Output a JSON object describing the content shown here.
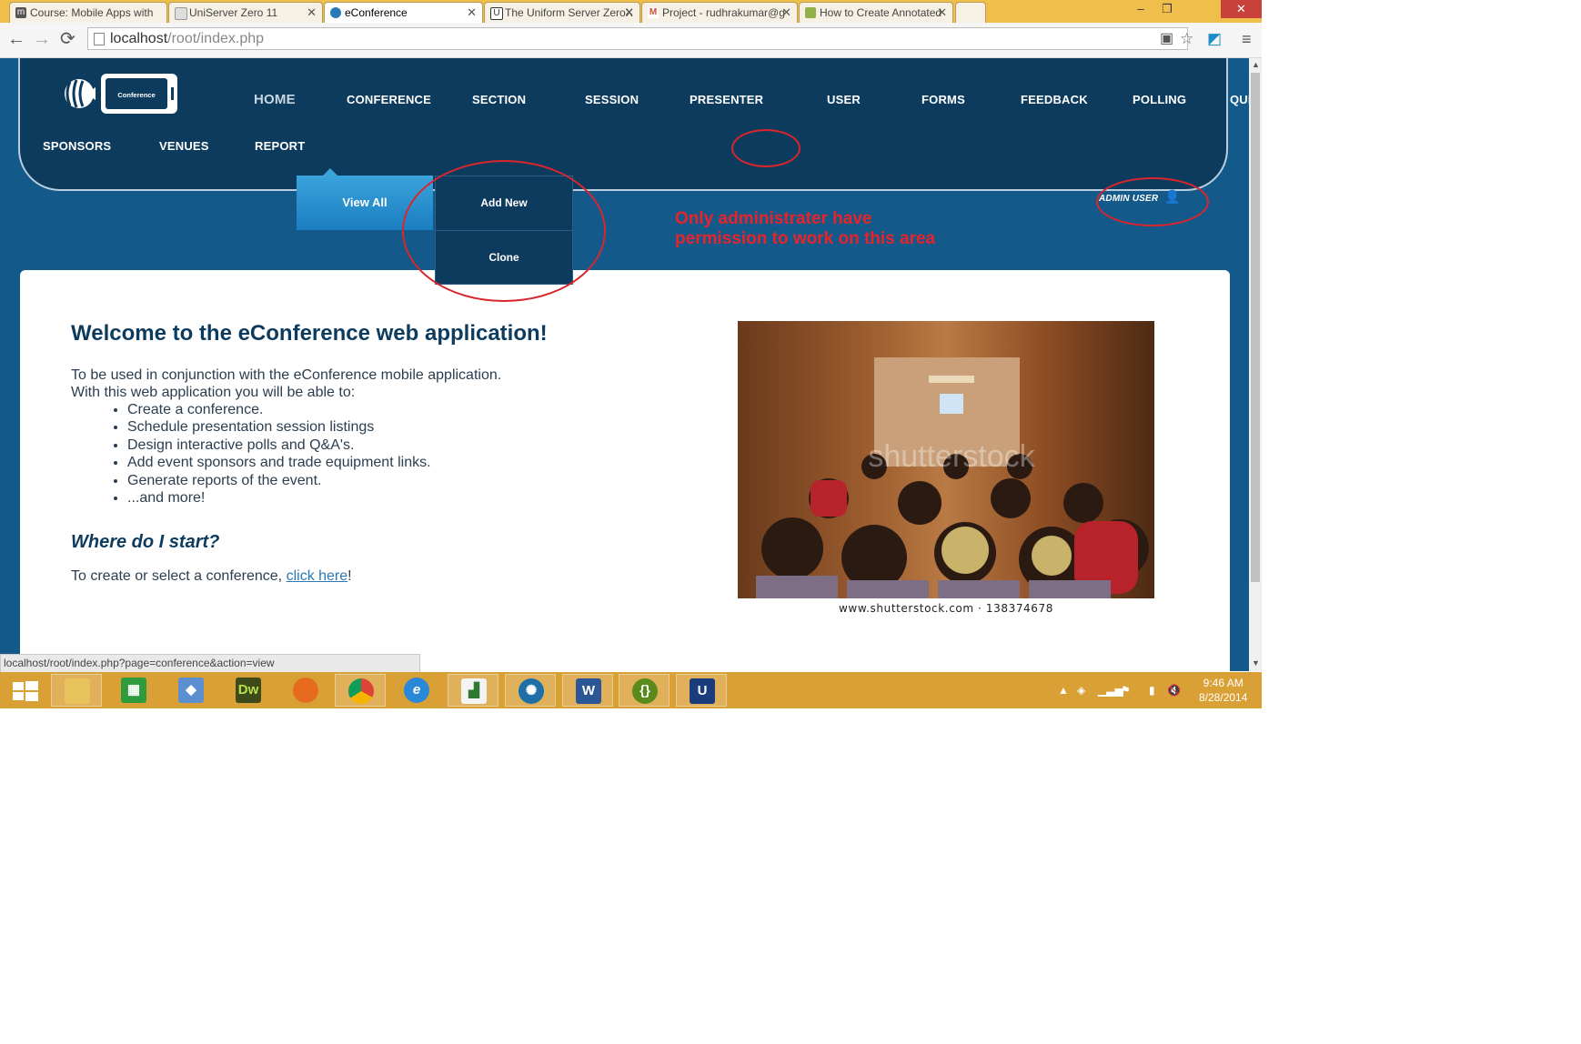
{
  "browser": {
    "tabs": [
      {
        "label": "Course: Mobile Apps with",
        "icon": "moodle-icon",
        "active": false
      },
      {
        "label": "UniServer Zero 11",
        "icon": "page-icon",
        "active": false
      },
      {
        "label": "eConference",
        "icon": "econference-icon",
        "active": true
      },
      {
        "label": "The Uniform Server ZeroX",
        "icon": "uniserver-icon",
        "active": false
      },
      {
        "label": "Project - rudhrakumar@g",
        "icon": "gmail-icon",
        "active": false
      },
      {
        "label": "How to Create Annotated",
        "icon": "wikihow-icon",
        "active": false
      }
    ],
    "address": {
      "host": "localhost",
      "path": "/root/index.php"
    },
    "window_controls": {
      "minimize": "–",
      "restore": "❐",
      "close": "✕"
    }
  },
  "site": {
    "logo_text": "Conference",
    "nav_row1": [
      "HOME",
      "CONFERENCE",
      "SECTION",
      "SESSION",
      "PRESENTER",
      "USER",
      "FORMS",
      "FEEDBACK",
      "POLLING",
      "QUESTIONS"
    ],
    "nav_row2": [
      "SPONSORS",
      "VENUES",
      "REPORT"
    ],
    "dropdown": {
      "view_all": "View All",
      "add_new": "Add New",
      "clone": "Clone"
    },
    "admin_user": "ADMIN USER",
    "annotation_note": "Only administrater have\npermission to work on this area",
    "annotation_color": "#e8232a"
  },
  "content": {
    "welcome": "Welcome to the eConference web application!",
    "intro_line1": "To be used in conjunction with the eConference mobile application.",
    "intro_line2": "With this web application you will be able to:",
    "features": [
      "Create a conference.",
      "Schedule presentation session listings",
      "Design interactive polls and Q&A's.",
      "Add event sponsors and trade equipment links.",
      "Generate reports of the event.",
      "...and more!"
    ],
    "start_heading": "Where do I start?",
    "start_text": "To create or select a conference, ",
    "start_link": "click here",
    "start_end": "!",
    "photo_caption": "www.shutterstock.com · 138374678",
    "photo_watermark": "shutterstock"
  },
  "status_bar": {
    "url": "localhost/root/index.php?page=conference&action=view"
  },
  "taskbar": {
    "apps": [
      "start-button",
      "file-explorer",
      "store",
      "virtualbox",
      "dreamweaver",
      "firefox",
      "chrome",
      "internet-explorer",
      "sheet-app",
      "network-app",
      "word",
      "brackets",
      "uniserver"
    ],
    "clock_time": "9:46 AM",
    "clock_date": "8/28/2014"
  },
  "colors": {
    "header_bg": "#0d3b5e",
    "accent": "#1b7ec0",
    "taskbar": "#d9a036",
    "tabstrip": "#f0be4a"
  }
}
